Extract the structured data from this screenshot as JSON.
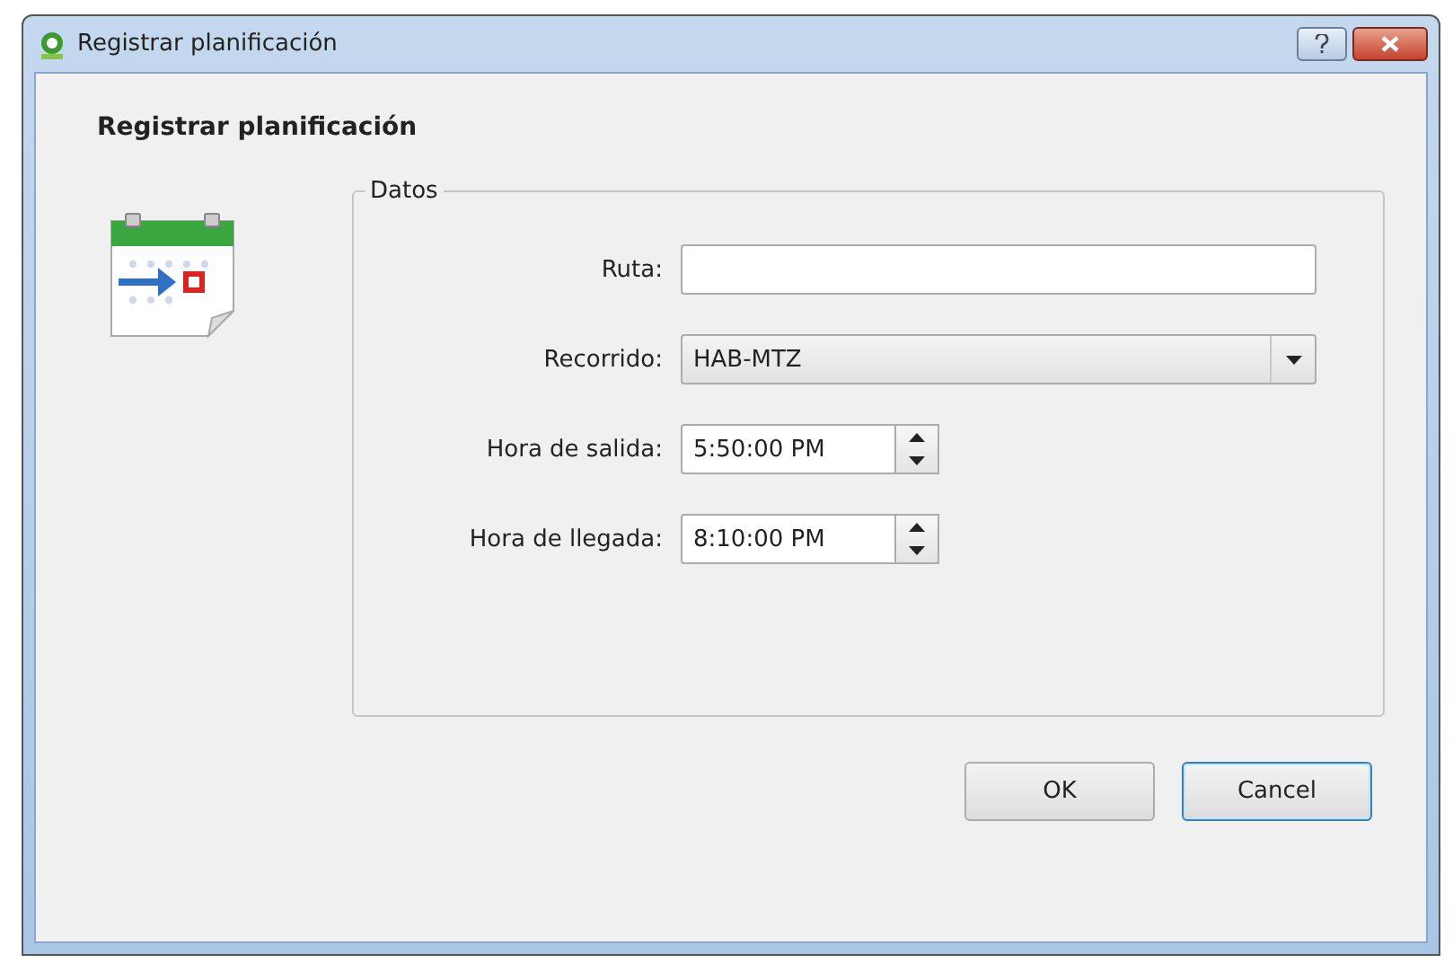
{
  "window": {
    "title": "Registrar planificación"
  },
  "heading": "Registrar planificación",
  "group": {
    "title": "Datos",
    "fields": [
      {
        "label": "Ruta:",
        "kind": "text"
      },
      {
        "label": "Recorrido:",
        "kind": "combo",
        "value": "HAB-MTZ"
      },
      {
        "label": "Hora de salida:",
        "kind": "spin",
        "value": "5:50:00 PM"
      },
      {
        "label": "Hora de llegada:",
        "kind": "spin",
        "value": "8:10:00 PM"
      }
    ]
  },
  "buttons": [
    {
      "label": "OK",
      "focused": false
    },
    {
      "label": "Cancel",
      "focused": true
    }
  ]
}
